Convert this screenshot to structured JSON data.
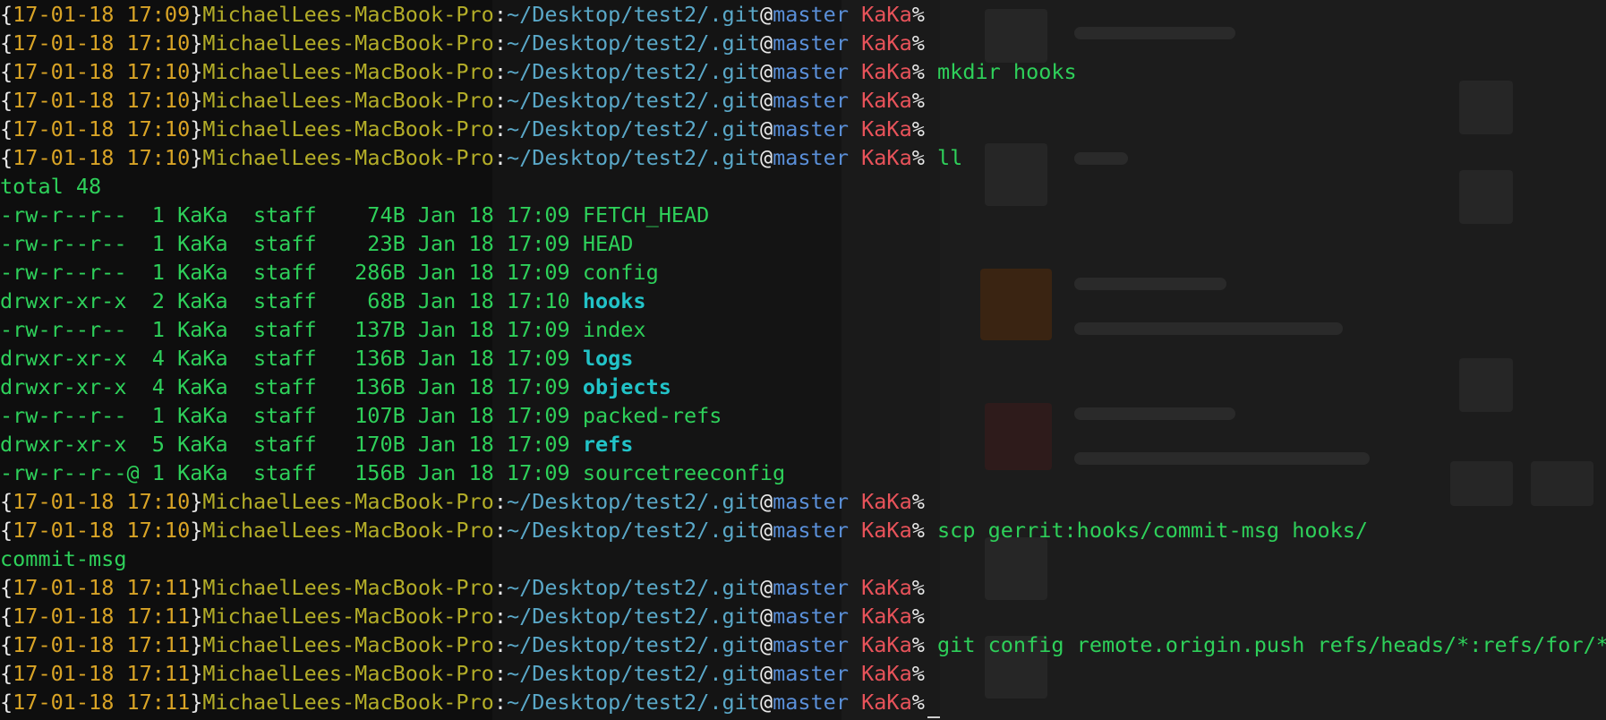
{
  "host": "MichaelLees-MacBook-Pro",
  "path": "~/Desktop/test2/.git",
  "at": "@",
  "branch": "master",
  "user": "KaKa",
  "lines": [
    {
      "kind": "prompt",
      "ts": "17-01-18 17:09",
      "cmd": ""
    },
    {
      "kind": "prompt",
      "ts": "17-01-18 17:10",
      "cmd": ""
    },
    {
      "kind": "prompt",
      "ts": "17-01-18 17:10",
      "cmd": " mkdir hooks"
    },
    {
      "kind": "prompt",
      "ts": "17-01-18 17:10",
      "cmd": ""
    },
    {
      "kind": "prompt",
      "ts": "17-01-18 17:10",
      "cmd": ""
    },
    {
      "kind": "prompt",
      "ts": "17-01-18 17:10",
      "cmd": " ll"
    },
    {
      "kind": "text",
      "text": "total 48"
    },
    {
      "kind": "ls",
      "meta": "-rw-r--r--  1 KaKa  staff    74B Jan 18 17:09 ",
      "name": "FETCH_HEAD",
      "dir": false
    },
    {
      "kind": "ls",
      "meta": "-rw-r--r--  1 KaKa  staff    23B Jan 18 17:09 ",
      "name": "HEAD",
      "dir": false
    },
    {
      "kind": "ls",
      "meta": "-rw-r--r--  1 KaKa  staff   286B Jan 18 17:09 ",
      "name": "config",
      "dir": false
    },
    {
      "kind": "ls",
      "meta": "drwxr-xr-x  2 KaKa  staff    68B Jan 18 17:10 ",
      "name": "hooks",
      "dir": true
    },
    {
      "kind": "ls",
      "meta": "-rw-r--r--  1 KaKa  staff   137B Jan 18 17:09 ",
      "name": "index",
      "dir": false
    },
    {
      "kind": "ls",
      "meta": "drwxr-xr-x  4 KaKa  staff   136B Jan 18 17:09 ",
      "name": "logs",
      "dir": true
    },
    {
      "kind": "ls",
      "meta": "drwxr-xr-x  4 KaKa  staff   136B Jan 18 17:09 ",
      "name": "objects",
      "dir": true
    },
    {
      "kind": "ls",
      "meta": "-rw-r--r--  1 KaKa  staff   107B Jan 18 17:09 ",
      "name": "packed-refs",
      "dir": false
    },
    {
      "kind": "ls",
      "meta": "drwxr-xr-x  5 KaKa  staff   170B Jan 18 17:09 ",
      "name": "refs",
      "dir": true
    },
    {
      "kind": "ls",
      "meta": "-rw-r--r--@ 1 KaKa  staff   156B Jan 18 17:09 ",
      "name": "sourcetreeconfig",
      "dir": false
    },
    {
      "kind": "prompt",
      "ts": "17-01-18 17:10",
      "cmd": ""
    },
    {
      "kind": "prompt",
      "ts": "17-01-18 17:10",
      "cmd": " scp gerrit:hooks/commit-msg hooks/"
    },
    {
      "kind": "text",
      "text": "commit-msg"
    },
    {
      "kind": "prompt",
      "ts": "17-01-18 17:11",
      "cmd": ""
    },
    {
      "kind": "prompt",
      "ts": "17-01-18 17:11",
      "cmd": ""
    },
    {
      "kind": "prompt",
      "ts": "17-01-18 17:11",
      "cmd": " git config remote.origin.push refs/heads/*:refs/for/*"
    },
    {
      "kind": "prompt",
      "ts": "17-01-18 17:11",
      "cmd": ""
    },
    {
      "kind": "prompt",
      "ts": "17-01-18 17:11",
      "cmd": ""
    }
  ]
}
